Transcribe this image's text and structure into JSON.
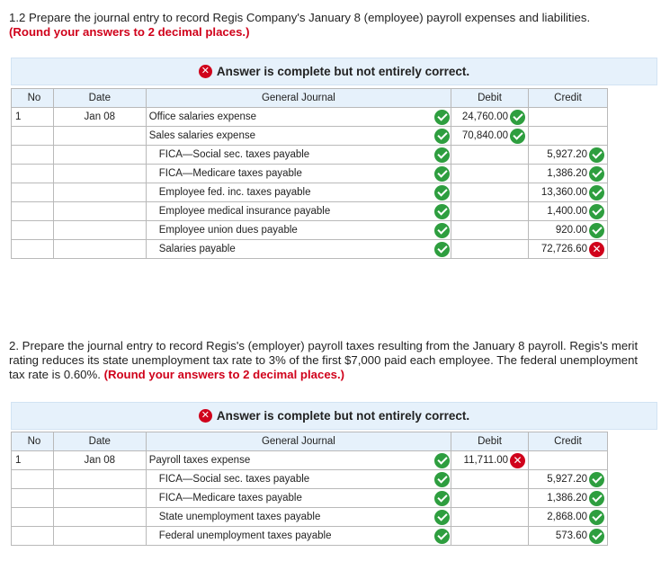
{
  "part1": {
    "question": "1.2 Prepare the journal entry to record Regis Company's January 8 (employee) payroll expenses and liabilities.",
    "instruction": "(Round your answers to 2 decimal places.)",
    "banner": "Answer is complete but not entirely correct.",
    "columns": [
      "No",
      "Date",
      "General Journal",
      "Debit",
      "Credit"
    ],
    "rows": [
      {
        "no": "1",
        "date": "Jan 08",
        "account": "Office salaries expense",
        "debit": "24,760.00",
        "credit": "",
        "acct_status": "correct",
        "amt_status": "correct"
      },
      {
        "no": "",
        "date": "",
        "account": "Sales salaries expense",
        "debit": "70,840.00",
        "credit": "",
        "acct_status": "correct",
        "amt_status": "correct"
      },
      {
        "no": "",
        "date": "",
        "account": "FICA—Social sec. taxes payable",
        "debit": "",
        "credit": "5,927.20",
        "acct_status": "correct",
        "amt_status": "correct"
      },
      {
        "no": "",
        "date": "",
        "account": "FICA—Medicare taxes payable",
        "debit": "",
        "credit": "1,386.20",
        "acct_status": "correct",
        "amt_status": "correct"
      },
      {
        "no": "",
        "date": "",
        "account": "Employee fed. inc. taxes payable",
        "debit": "",
        "credit": "13,360.00",
        "acct_status": "correct",
        "amt_status": "correct"
      },
      {
        "no": "",
        "date": "",
        "account": "Employee medical insurance payable",
        "debit": "",
        "credit": "1,400.00",
        "acct_status": "correct",
        "amt_status": "correct"
      },
      {
        "no": "",
        "date": "",
        "account": "Employee union dues payable",
        "debit": "",
        "credit": "920.00",
        "acct_status": "correct",
        "amt_status": "correct"
      },
      {
        "no": "",
        "date": "",
        "account": "Salaries payable",
        "debit": "",
        "credit": "72,726.60",
        "acct_status": "correct",
        "amt_status": "incorrect"
      }
    ]
  },
  "part2": {
    "question": "2. Prepare the journal entry to record Regis's (employer) payroll taxes resulting from the January 8 payroll. Regis's merit rating reduces its state unemployment tax rate to 3% of the first $7,000 paid each employee. The federal unemployment tax rate is 0.60%.",
    "instruction": "(Round your answers to 2 decimal places.)",
    "banner": "Answer is complete but not entirely correct.",
    "columns": [
      "No",
      "Date",
      "General Journal",
      "Debit",
      "Credit"
    ],
    "rows": [
      {
        "no": "1",
        "date": "Jan 08",
        "account": "Payroll taxes expense",
        "debit": "11,711.00",
        "credit": "",
        "acct_status": "correct",
        "amt_status": "incorrect"
      },
      {
        "no": "",
        "date": "",
        "account": "FICA—Social sec. taxes payable",
        "debit": "",
        "credit": "5,927.20",
        "acct_status": "correct",
        "amt_status": "correct"
      },
      {
        "no": "",
        "date": "",
        "account": "FICA—Medicare taxes payable",
        "debit": "",
        "credit": "1,386.20",
        "acct_status": "correct",
        "amt_status": "correct"
      },
      {
        "no": "",
        "date": "",
        "account": "State unemployment taxes payable",
        "debit": "",
        "credit": "2,868.00",
        "acct_status": "correct",
        "amt_status": "correct"
      },
      {
        "no": "",
        "date": "",
        "account": "Federal unemployment taxes payable",
        "debit": "",
        "credit": "573.60",
        "acct_status": "correct",
        "amt_status": "correct"
      }
    ]
  },
  "icons": {
    "correct": "check-circle-icon",
    "incorrect": "x-circle-icon"
  },
  "colors": {
    "accent_red": "#d0021b",
    "check_green": "#2e9e3f",
    "header_blue": "#e6f1fb"
  }
}
